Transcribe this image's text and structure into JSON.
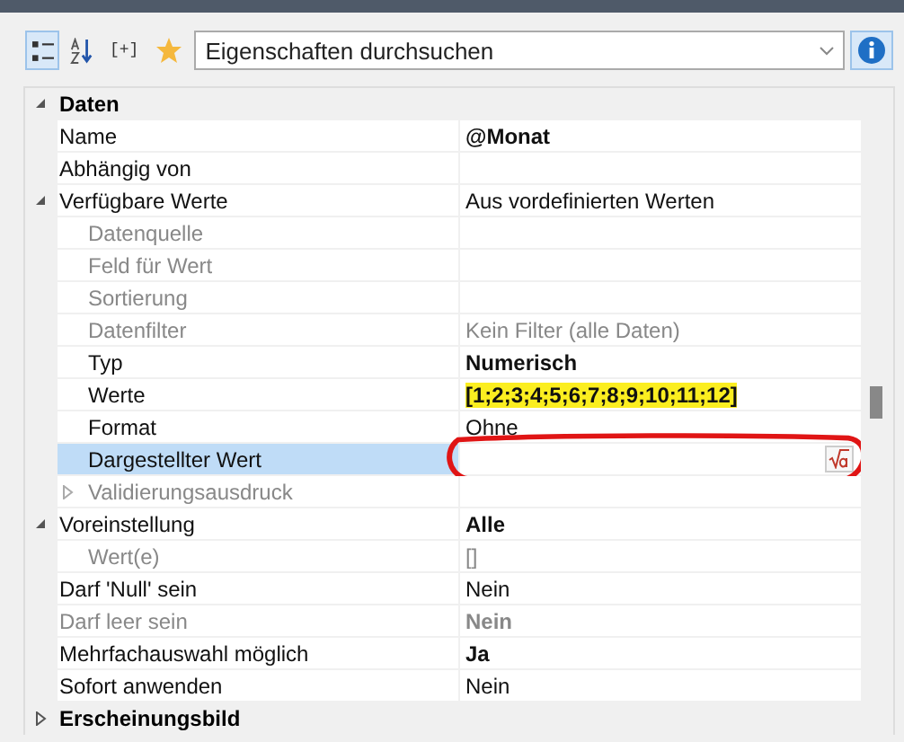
{
  "toolbar": {
    "buttons": [
      {
        "kind": "categorized",
        "selected": true
      },
      {
        "kind": "alphabetical",
        "selected": false
      },
      {
        "kind": "text",
        "label": "[+]",
        "selected": false
      },
      {
        "kind": "favorite",
        "selected": false
      }
    ],
    "search": {
      "placeholder": "Eigenschaften durchsuchen"
    },
    "info_button": {
      "selected": true
    }
  },
  "grid": {
    "rows": [
      {
        "kind": "category",
        "label": "Daten",
        "expanded": true
      },
      {
        "kind": "property",
        "label": "Name",
        "value": "@Monat",
        "value_bold": true
      },
      {
        "kind": "property",
        "label": "Abhängig von"
      },
      {
        "kind": "property",
        "label": "Verfügbare Werte",
        "value": "Aus vordefinierten Werten",
        "expanded": true
      },
      {
        "kind": "property",
        "label": "Datenquelle",
        "child": true,
        "disabled": true
      },
      {
        "kind": "property",
        "label": "Feld für Wert",
        "child": true,
        "disabled": true
      },
      {
        "kind": "property",
        "label": "Sortierung",
        "child": true,
        "disabled": true
      },
      {
        "kind": "property",
        "label": "Datenfilter",
        "child": true,
        "disabled": true,
        "value": "Kein Filter (alle Daten)"
      },
      {
        "kind": "property",
        "label": "Typ",
        "child": true,
        "value": "Numerisch",
        "value_bold": true
      },
      {
        "kind": "property",
        "label": "Werte",
        "child": true,
        "value": "[1;2;3;4;5;6;7;8;9;10;11;12]",
        "value_bold": true,
        "highlighted": true
      },
      {
        "kind": "property",
        "label": "Format",
        "child": true,
        "value": "Ohne"
      },
      {
        "kind": "editor",
        "label": "Dargestellter Wert",
        "child": true,
        "selected": true,
        "circled": true
      },
      {
        "kind": "property",
        "label": "Validierungsausdruck",
        "child": true,
        "disabled": true,
        "expanded": false
      },
      {
        "kind": "property",
        "label": "Voreinstellung",
        "value": "Alle",
        "value_bold": true,
        "expanded": true
      },
      {
        "kind": "property",
        "label": "Wert(e)",
        "child": true,
        "disabled": true,
        "value": "[]"
      },
      {
        "kind": "property",
        "label": "Darf 'Null' sein",
        "value": "Nein"
      },
      {
        "kind": "property",
        "label": "Darf leer sein",
        "disabled": true,
        "value": "Nein",
        "value_bold": true
      },
      {
        "kind": "property",
        "label": "Mehrfachauswahl möglich",
        "value": "Ja",
        "value_bold": true
      },
      {
        "kind": "property",
        "label": "Sofort anwenden",
        "value": "Nein"
      },
      {
        "kind": "category",
        "label": "Erscheinungsbild",
        "expanded": false
      }
    ]
  }
}
